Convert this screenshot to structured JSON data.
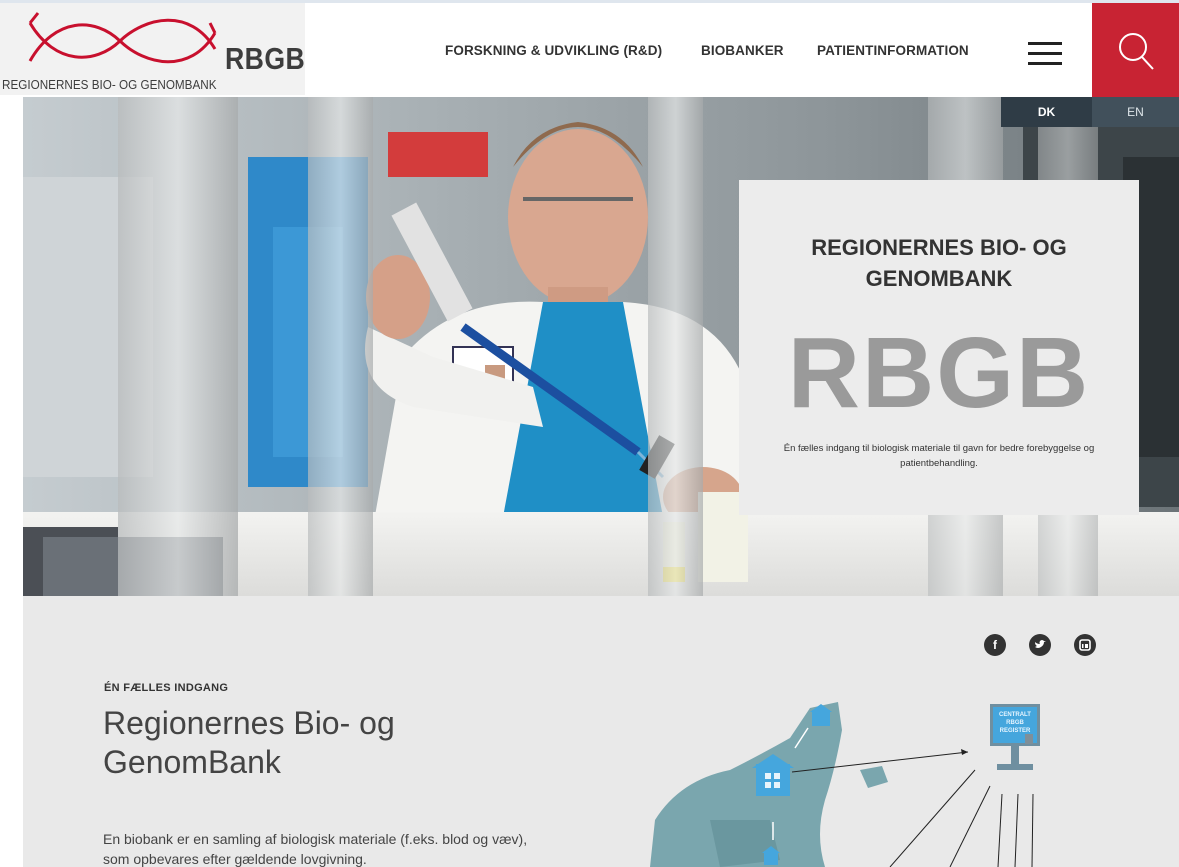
{
  "logo": {
    "abbr": "RBGB",
    "full_name": "REGIONERNES BIO- OG GENOMBANK"
  },
  "nav": {
    "items": [
      "FORSKNING & UDVIKLING (R&D)",
      "BIOBANKER",
      "PATIENTINFORMATION"
    ],
    "menu_icon": "hamburger-icon",
    "search_icon": "search-icon"
  },
  "language": {
    "options": [
      "DK",
      "EN"
    ],
    "selected": "DK"
  },
  "hero": {
    "title": "REGIONERNES BIO- OG GENOMBANK",
    "big_text": "RBGB",
    "subtitle": "Én fælles indgang til biologisk materiale til gavn for bedre forebyggelse og patientbehandling."
  },
  "social": {
    "icons": [
      "facebook-icon",
      "twitter-icon",
      "linkedin-icon"
    ]
  },
  "intro": {
    "eyebrow": "ÉN FÆLLES INDGANG",
    "heading": "Regionernes Bio- og GenomBank",
    "body": "En biobank er en samling af biologisk materiale (f.eks. blod og væv), som opbevares efter gældende lovgivning."
  },
  "map": {
    "register_label_lines": [
      "CENTRALT",
      "RBGB",
      "REGISTER"
    ]
  },
  "colors": {
    "brand_red": "#c82333",
    "lang_active_bg": "#2f3c46",
    "map_land": "#7aa6ae",
    "register_blue": "#45a6dd"
  }
}
